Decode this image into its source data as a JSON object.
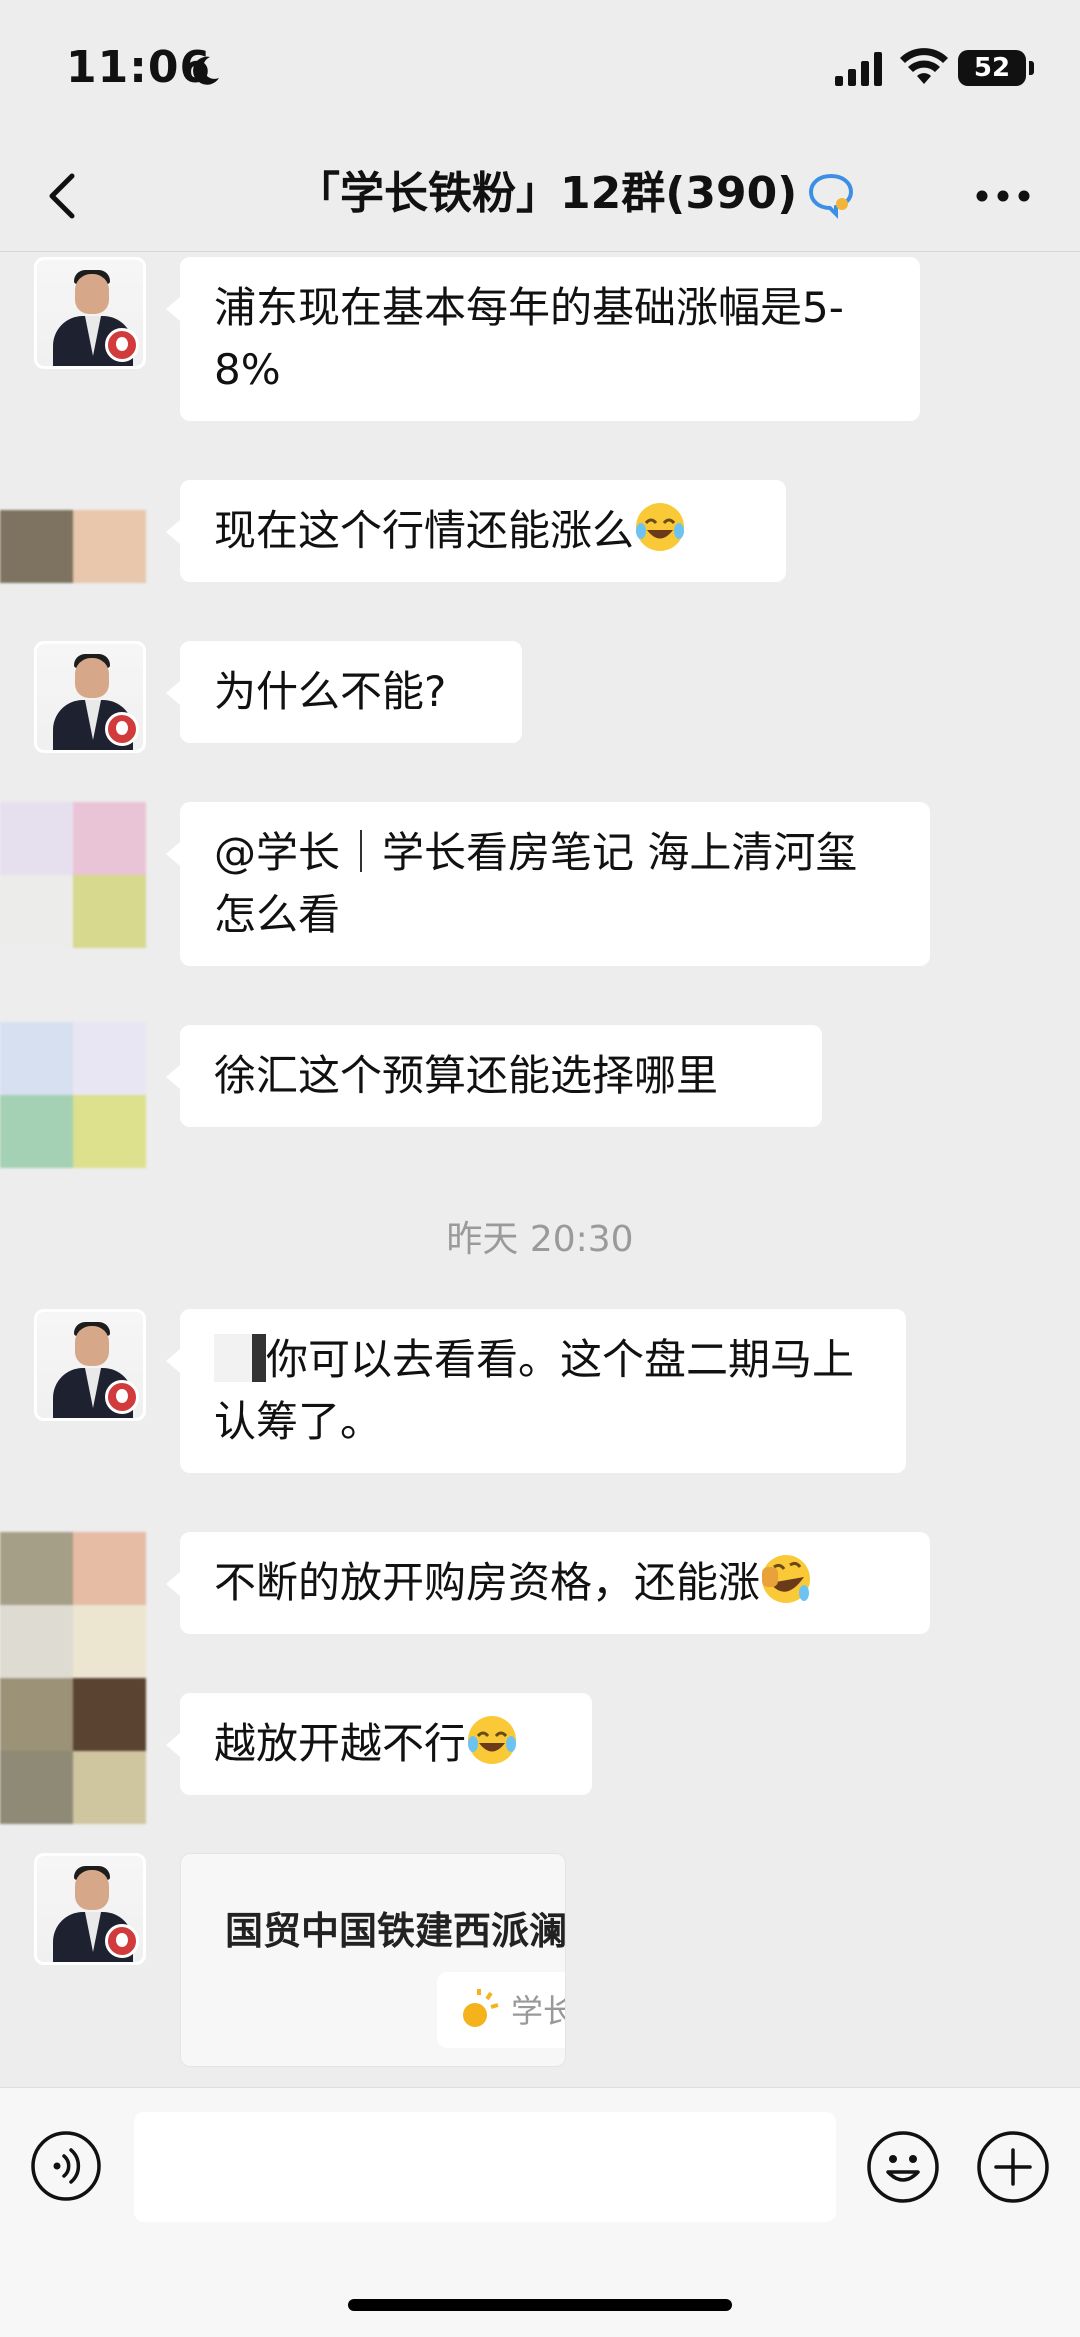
{
  "status_bar": {
    "time": "11:06",
    "battery": "52"
  },
  "nav": {
    "title": "「学长铁粉」12群(390)"
  },
  "messages": [
    {
      "text": "浦东现在基本每年的基础涨幅是5-8%"
    },
    {
      "text": "现在这个行情还能涨么"
    },
    {
      "text": "为什么不能?"
    },
    {
      "text": "@学长｜学长看房笔记 海上清河玺怎么看"
    },
    {
      "text": "徐汇这个预算还能选择哪里"
    },
    {
      "text": "你可以去看看。这个盘二期马上认筹了。"
    },
    {
      "text": "不断的放开购房资格，还能涨"
    },
    {
      "text": "越放开越不行"
    }
  ],
  "timestamp": "昨天 20:30",
  "card": {
    "title": "国贸中国铁建西派澜",
    "source": "学长"
  },
  "icons": {
    "back": "chevron-left-icon",
    "more": "more-dots-icon",
    "voice": "voice-icon",
    "emoji": "smile-icon",
    "plus": "plus-icon"
  },
  "colors": {
    "background": "#ededed",
    "bubble": "#ffffff"
  }
}
